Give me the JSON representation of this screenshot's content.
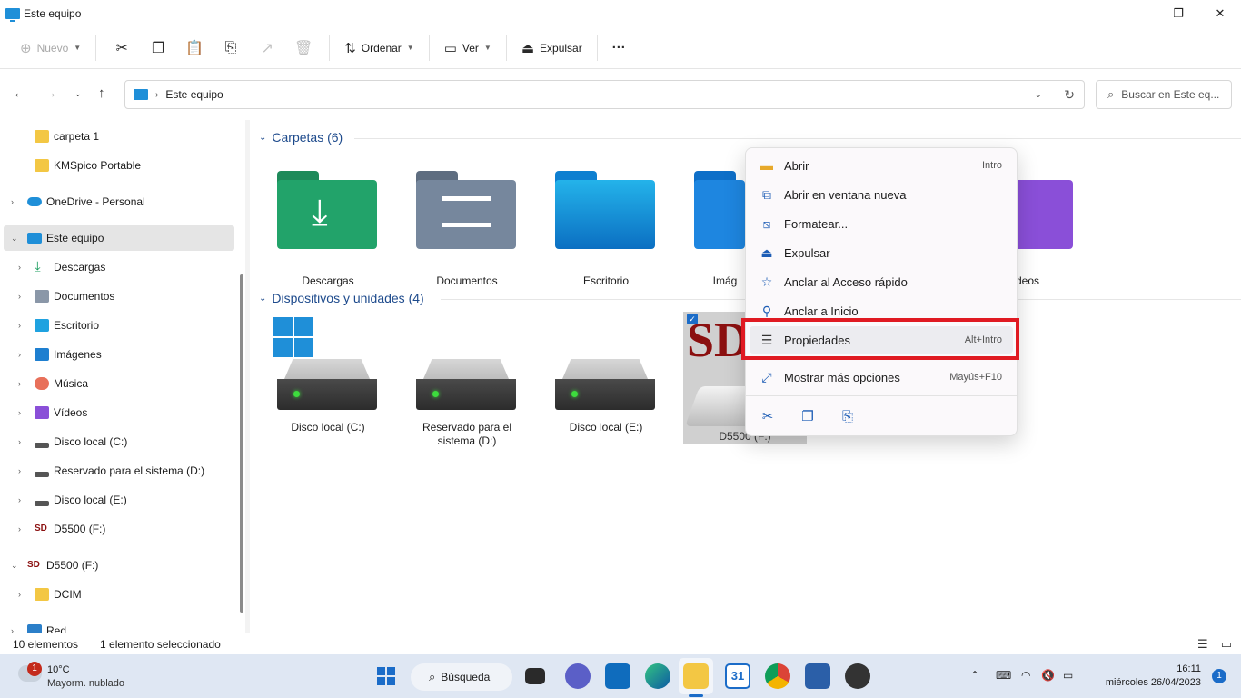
{
  "window": {
    "title": "Este equipo",
    "minimize": "—",
    "maximize": "❐",
    "close": "✕"
  },
  "toolbar": {
    "new_label": "Nuevo",
    "sort_label": "Ordenar",
    "view_label": "Ver",
    "eject_label": "Expulsar",
    "more_label": "···"
  },
  "address": {
    "path": "Este equipo",
    "search_placeholder": "Buscar en Este eq..."
  },
  "sidebar": {
    "items": [
      {
        "label": "carpeta 1"
      },
      {
        "label": "KMSpico Portable"
      },
      {
        "label": "OneDrive - Personal"
      },
      {
        "label": "Este equipo"
      },
      {
        "label": "Descargas"
      },
      {
        "label": "Documentos"
      },
      {
        "label": "Escritorio"
      },
      {
        "label": "Imágenes"
      },
      {
        "label": "Música"
      },
      {
        "label": "Vídeos"
      },
      {
        "label": "Disco local (C:)"
      },
      {
        "label": "Reservado para el sistema (D:)"
      },
      {
        "label": "Disco local (E:)"
      },
      {
        "label": "D5500 (F:)"
      },
      {
        "label": "D5500 (F:)"
      },
      {
        "label": "DCIM"
      },
      {
        "label": "Red"
      }
    ]
  },
  "content": {
    "folders_header": "Carpetas (6)",
    "devices_header": "Dispositivos y unidades (4)",
    "folders": [
      {
        "name": "Descargas"
      },
      {
        "name": "Documentos"
      },
      {
        "name": "Escritorio"
      },
      {
        "name": "Imág"
      },
      {
        "name": "deos"
      }
    ],
    "devices": [
      {
        "name": "Disco local (C:)"
      },
      {
        "name": "Reservado para el sistema (D:)"
      },
      {
        "name": "Disco local (E:)"
      },
      {
        "name": "D5500 (F:)"
      }
    ],
    "sd_label": "SD"
  },
  "context_menu": {
    "items": [
      {
        "label": "Abrir",
        "shortcut": "Intro"
      },
      {
        "label": "Abrir en ventana nueva",
        "shortcut": ""
      },
      {
        "label": "Formatear...",
        "shortcut": ""
      },
      {
        "label": "Expulsar",
        "shortcut": ""
      },
      {
        "label": "Anclar al Acceso rápido",
        "shortcut": ""
      },
      {
        "label": "Anclar a Inicio",
        "shortcut": ""
      },
      {
        "label": "Propiedades",
        "shortcut": "Alt+Intro"
      },
      {
        "label": "Mostrar más opciones",
        "shortcut": "Mayús+F10"
      }
    ]
  },
  "status": {
    "count": "10 elementos",
    "selection": "1 elemento seleccionado"
  },
  "taskbar": {
    "weather_temp": "10°C",
    "weather_desc": "Mayorm. nublado",
    "weather_badge": "1",
    "search_label": "Búsqueda",
    "calendar_day": "31",
    "time": "16:11",
    "date": "miércoles 26/04/2023",
    "notifications": "1"
  },
  "colors": {
    "accent": "#1b6cc8",
    "highlight_box": "#e01a22",
    "folder_header": "#1d4a8c"
  }
}
